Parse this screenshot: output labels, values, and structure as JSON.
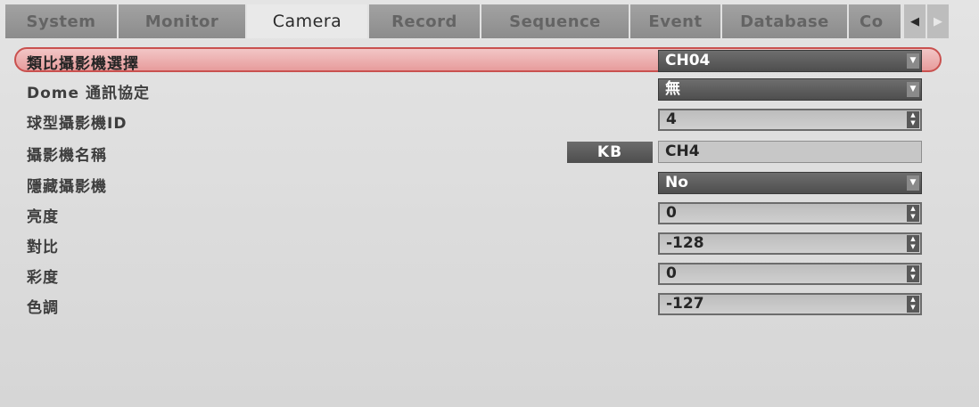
{
  "tabs": [
    {
      "label": "System"
    },
    {
      "label": "Monitor"
    },
    {
      "label": "Camera",
      "active": true
    },
    {
      "label": "Record"
    },
    {
      "label": "Sequence"
    },
    {
      "label": "Event"
    },
    {
      "label": "Database"
    },
    {
      "label": "Co"
    }
  ],
  "tab_nav": {
    "prev_icon": "triangle-left-icon",
    "next_icon": "triangle-right-icon"
  },
  "settings": {
    "analog_camera": {
      "label": "類比攝影機選擇",
      "value": "CH04"
    },
    "dome_protocol": {
      "label": "Dome 通訊協定",
      "value": "無"
    },
    "dome_id": {
      "label": "球型攝影機ID",
      "value": "4"
    },
    "camera_name": {
      "label": "攝影機名稱",
      "kb_label": "KB",
      "value": "CH4"
    },
    "hidden_camera": {
      "label": "隱藏攝影機",
      "value": "No"
    },
    "brightness": {
      "label": "亮度",
      "value": "0"
    },
    "contrast": {
      "label": "對比",
      "value": "-128"
    },
    "saturation": {
      "label": "彩度",
      "value": "0"
    },
    "hue": {
      "label": "色調",
      "value": "-127"
    }
  },
  "colors": {
    "selection": "#e79c9c",
    "selection_border": "#c9514f",
    "dropdown": "#5a5a5a"
  }
}
